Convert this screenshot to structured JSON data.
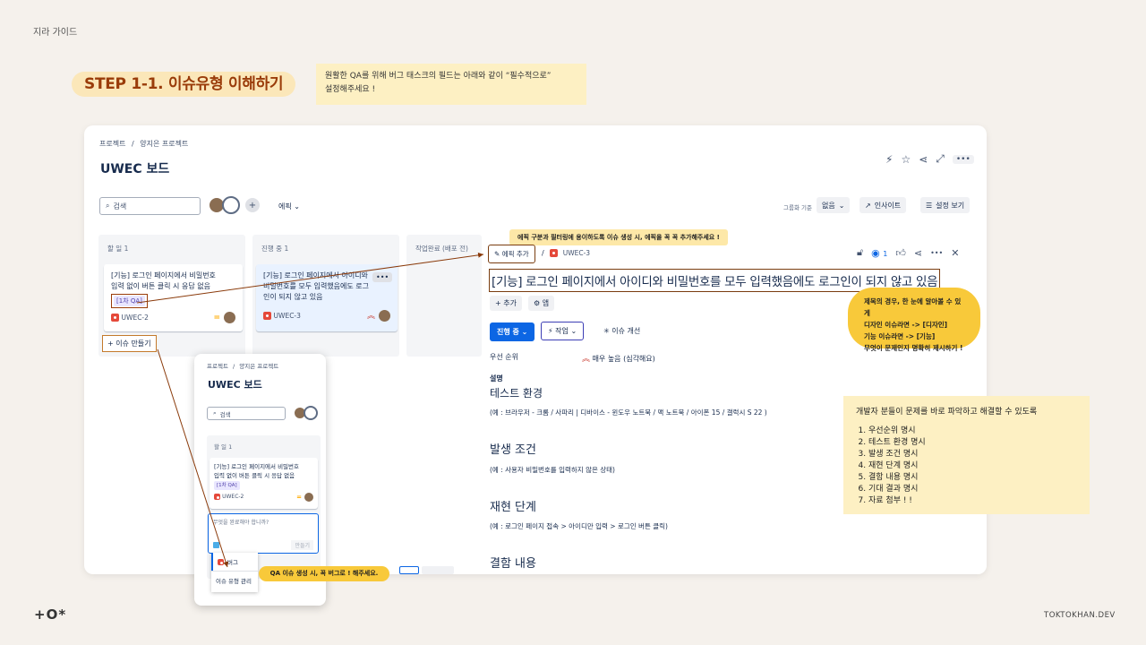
{
  "header": {
    "guide_label": "지라 가이드",
    "step_title": "STEP 1-1. 이슈유형 이해하기",
    "instruction_line1": "원활한 QA를 위해 버그 태스크의 필드는 아래와 같이 “필수적으로”",
    "instruction_line2": "설정해주세요 !"
  },
  "board": {
    "breadcrumb_root": "프로젝트",
    "breadcrumb_sep": "/",
    "breadcrumb_project": "양지은 프로젝트",
    "title": "UWEC 보드",
    "search_placeholder": "검색",
    "epic_filter": "에픽",
    "group_by_label": "그룹화 기준",
    "group_by_value": "없음",
    "insight_label": "인사이트",
    "settings_label": "설정 보기",
    "columns": [
      {
        "title": "할 일 1"
      },
      {
        "title": "진행 중 1"
      },
      {
        "title": "작업완료 (배포 전)"
      }
    ],
    "card1": {
      "summary_line1": "[기능] 로그인 페이지에서 비밀번호",
      "summary_line2": "입력 없이 버튼 클릭 시 응답 없음",
      "tag": "[1차 QA]",
      "key": "UWEC-2",
      "priority_glyph": "="
    },
    "card2": {
      "summary_line1": "[기능] 로그인 페이지에서 아이디와",
      "summary_line2": "비밀번호를 모두 입력했음에도 로그",
      "summary_line3": "인이 되지 않고 있음",
      "key": "UWEC-3",
      "more": "•••"
    },
    "create_issue": "+ 이슈 만들기"
  },
  "detail": {
    "epic_note": "에픽 구분과 필터링에 용이하도록 이슈 생성 시, 에픽을 꼭 꼭 추가해주세요 !",
    "epic_button": "에픽 추가",
    "key_sep": "/",
    "issue_key": "UWEC-3",
    "watch_count": "1",
    "title": "[기능] 로그인 페이지에서 아이디와 비밀번호를 모두 입력했음에도 로그인이 되지 않고 있음",
    "add_label": "+ 추가",
    "app_label": "앱",
    "status_label": "진행 중",
    "work_label": "작업",
    "improve_label": "이슈 개선",
    "priority_label": "우선 순위",
    "priority_value": "매우 높음 (심각해요)",
    "description_label": "설명",
    "sections": [
      {
        "heading": "테스트 환경",
        "body": "(예 : 브라우저 - 크롬 / 사파리 | 디바이스 - 윈도우 노트북 / 맥 노트북 / 아이폰 15 / 갤럭시 S 22 )"
      },
      {
        "heading": "발생 조건",
        "body": "(예 : 사용자 비밀번호를 입력하지 않은 상태)"
      },
      {
        "heading": "재현 단계",
        "body": "(예 : 로그인 페이지 접속 > 아이디만 입력 > 로그인 버튼 클릭)"
      },
      {
        "heading": "결함 내용",
        "body": ""
      }
    ]
  },
  "bubble": {
    "line1": "제목의 경우, 한 눈에 알아볼 수 있게",
    "line2": "디자인 이슈라면 -> [디자인]",
    "line3": "기능 이슈라면 -> [기능]",
    "line4": "무엇이 문제인지 명확히 제시하기 !"
  },
  "checklist": {
    "title": "개발자 분들이 문제를 바로 파악하고 해결할 수 있도록",
    "items": [
      "우선순위 명시",
      "테스트 환경 명시",
      "발생 조건 명시",
      "재현 단계 명시",
      "결함 내용 명시",
      "기대 결과 명시",
      "자료 첨부 ! !"
    ]
  },
  "popup": {
    "breadcrumb_root": "프로젝트",
    "breadcrumb_sep": "/",
    "breadcrumb_project": "양지은 프로젝트",
    "title": "UWEC 보드",
    "search_placeholder": "검색",
    "column_title": "할 일 1",
    "card_line1": "[기능] 로그인 페이지에서 비밀번호",
    "card_line2": "입력 없이 버튼 클릭 시 응답 없음",
    "card_tag": "[1차 QA]",
    "card_key": "UWEC-2",
    "input_placeholder": "무엇을 완료해야 합니까?",
    "create_button": "만들기",
    "menu_bug": "버그",
    "menu_manage": "이슈 유형 관리"
  },
  "qa_note": "QA 이슈 생성 시, 꼭 버그로 ! 해주세요.",
  "footer": {
    "logo": "+O*",
    "brand": "TOKTOKHAN.DEV"
  },
  "colors": {
    "background": "#f5f1ec",
    "accent_orange": "#9a3c0a",
    "jira_blue": "#0c66e4",
    "note_yellow": "#f8c93a",
    "bug_red": "#e5493a"
  }
}
